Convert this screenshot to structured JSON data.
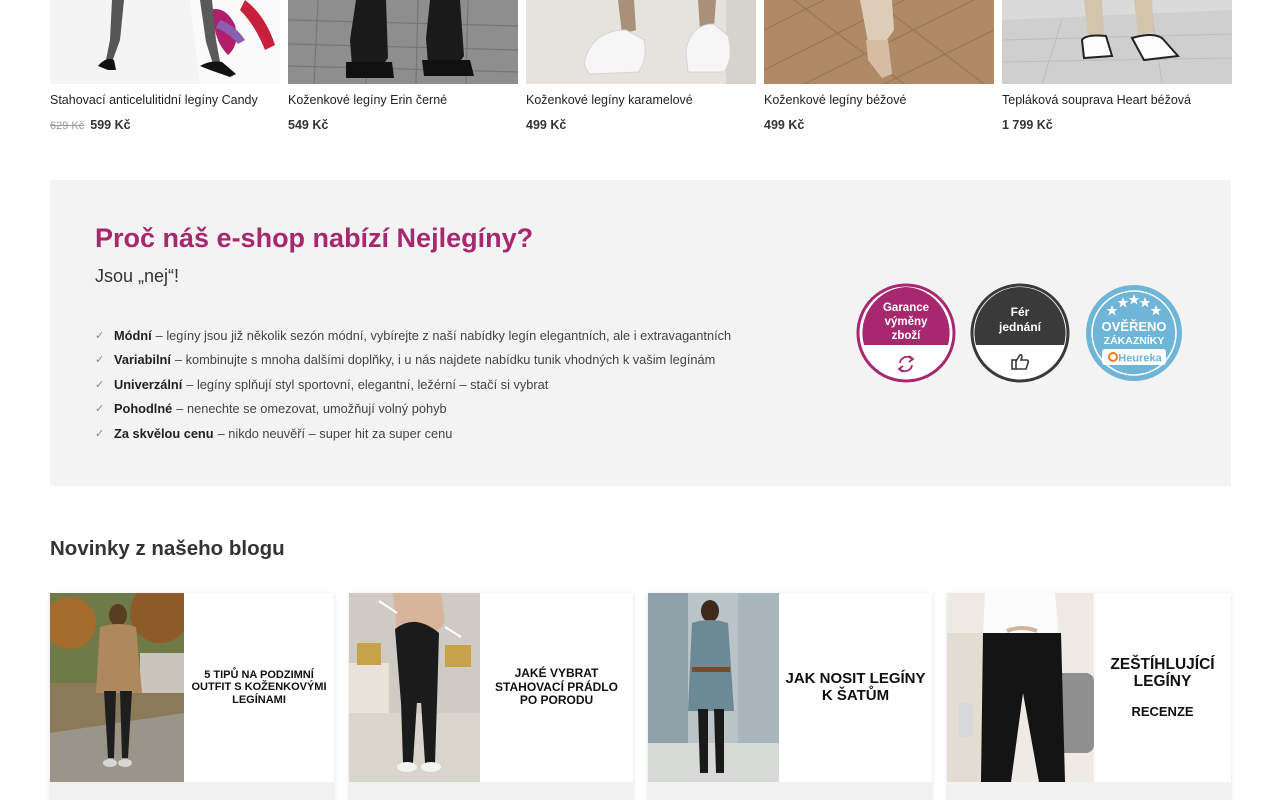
{
  "products": [
    {
      "name": "Stahovací anticelulitidní legíny Candy",
      "old_price": "629 Kč",
      "price": "599 Kč"
    },
    {
      "name": "Koženkové legíny Erin černé",
      "price": "549 Kč"
    },
    {
      "name": "Koženkové legíny karamelové",
      "price": "499 Kč"
    },
    {
      "name": "Koženkové legíny béžové",
      "price": "499 Kč"
    },
    {
      "name": "Tepláková souprava Heart béžová",
      "price": "1 799 Kč"
    }
  ],
  "why": {
    "title": "Proč náš e-shop nabízí Nejlegíny?",
    "subtitle": "Jsou „nej“!",
    "items": [
      {
        "bold": "Módní",
        "text": "– legíny jsou již několik sezón módní, vybírejte z naší nabídky legín elegantních, ale i extravagantních"
      },
      {
        "bold": "Variabilní",
        "text": "– kombinujte s mnoha dalšími doplňky, i u nás najdete nabídku tunik vhodných k vašim legínám"
      },
      {
        "bold": "Univerzální",
        "text": "– legíny splňují styl sportovní, elegantní, ležérní – stačí si vybrat"
      },
      {
        "bold": "Pohodlné",
        "text": "– nenechte se omezovat, umožňují volný pohyb"
      },
      {
        "bold": "Za skvělou cenu",
        "text": "– nikdo neuvěří – super hit za super cenu"
      }
    ],
    "badges": [
      {
        "line1": "Garance",
        "line2": "výměny",
        "line3": "zboží",
        "icon": "refresh-icon",
        "color": "#a7286f"
      },
      {
        "line1": "Fér",
        "line2": "jednání",
        "icon": "thumbs-up-icon",
        "color": "#3a3a3a"
      },
      {
        "line1": "OVĚŘENO",
        "line2": "ZÁKAZNÍKY",
        "line3": "Heureka",
        "icon": "stars-icon",
        "color": "#6fb5d8"
      }
    ]
  },
  "blog": {
    "title": "Novinky z našeho blogu",
    "posts": [
      {
        "lines": [
          "5 TIPŮ NA PODZIMNÍ",
          "OUTFIT S KOŽENKOVÝMI",
          "LEGÍNAMI"
        ]
      },
      {
        "lines": [
          "JAKÉ VYBRAT",
          "STAHOVACÍ PRÁDLO",
          "PO PORODU"
        ]
      },
      {
        "lines": [
          "JAK NOSIT LEGÍNY",
          "K ŠATŮM"
        ]
      },
      {
        "lines": [
          "ZEŠTÍHLUJÍCÍ",
          "LEGÍNY",
          "RECENZE"
        ]
      }
    ]
  },
  "colors": {
    "accent": "#a7286f",
    "panel": "#f3f3f3",
    "heureka": "#6fb5d8"
  }
}
